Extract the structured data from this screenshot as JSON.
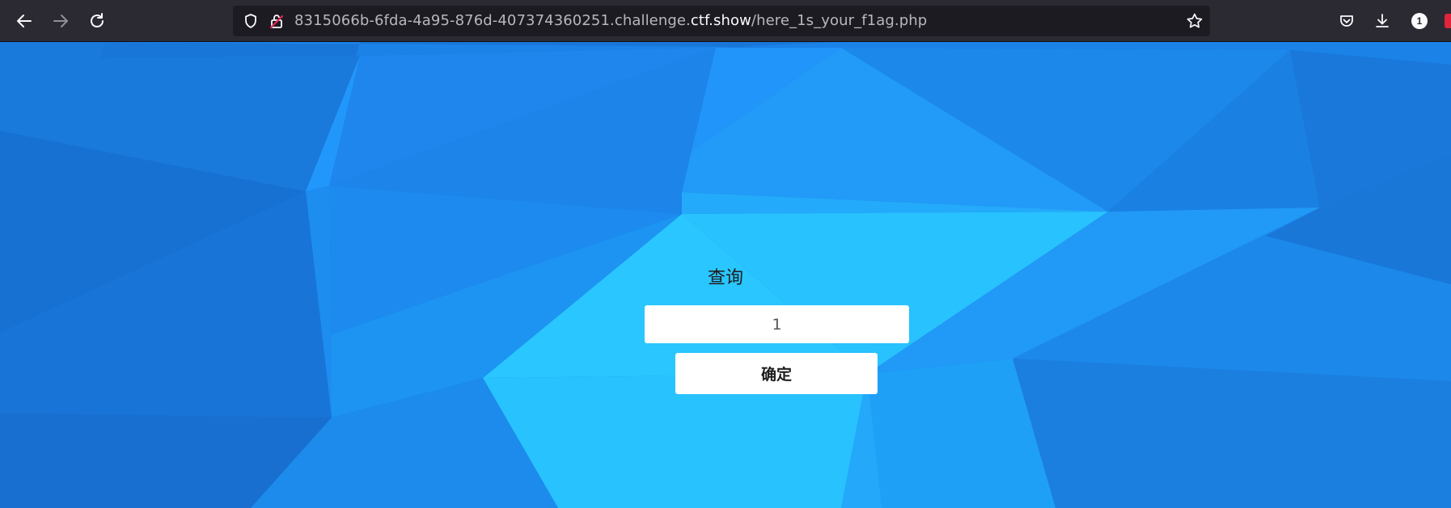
{
  "browser": {
    "url_prefix": "8315066b-6fda-4a95-876d-407374360251.challenge.",
    "url_domain": "ctf.show",
    "url_path": "/here_1s_your_f1ag.php",
    "extension_badge": "1",
    "icons": {
      "back": "back-arrow-icon",
      "forward": "forward-arrow-icon",
      "reload": "reload-icon",
      "tracking": "shield-icon",
      "insecure": "insecure-lock-icon",
      "bookmark": "star-icon",
      "pocket": "pocket-icon",
      "downloads": "download-icon"
    }
  },
  "page": {
    "title": "查询",
    "input_value": "1",
    "button_label": "确定",
    "colors": {
      "background": "#1a7fe0",
      "accent_light": "#29c6ff",
      "text": "#1e1e1e",
      "panel": "#ffffff"
    }
  }
}
